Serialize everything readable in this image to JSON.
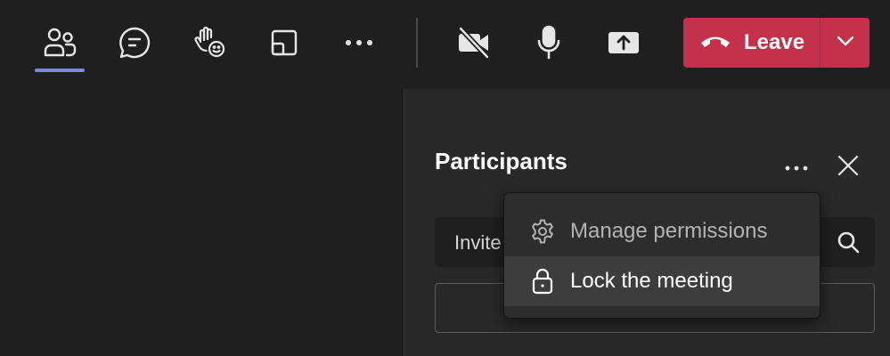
{
  "toolbar": {
    "buttons": [
      {
        "name": "people-icon",
        "active": true
      },
      {
        "name": "chat-icon"
      },
      {
        "name": "raise-hand-icon"
      },
      {
        "name": "rooms-icon"
      },
      {
        "name": "more-actions-icon"
      },
      {
        "name": "camera-off-icon"
      },
      {
        "name": "microphone-icon"
      },
      {
        "name": "share-screen-icon"
      }
    ],
    "leave_label": "Leave",
    "leave_color": "#c4314b",
    "accent_color": "#7f85f5"
  },
  "panel": {
    "title": "Participants",
    "invite_placeholder": "Invite"
  },
  "menu": {
    "items": [
      {
        "label": "Manage permissions",
        "icon": "gear-icon",
        "state": "disabled"
      },
      {
        "label": "Lock the meeting",
        "icon": "lock-icon",
        "state": "hover"
      }
    ]
  }
}
